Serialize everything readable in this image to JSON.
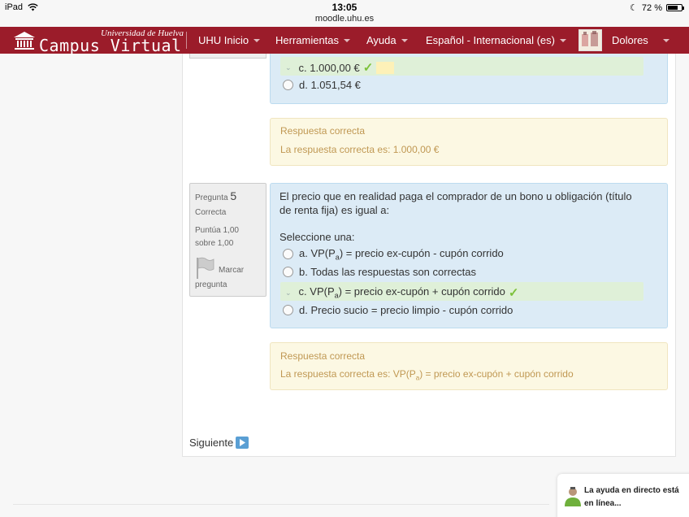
{
  "statusbar": {
    "device": "iPad",
    "time": "13:05",
    "url": "moodle.uhu.es",
    "battery": "72 %"
  },
  "navbar": {
    "logo_university": "Universidad de Huelva",
    "logo_title": "Campus Virtual",
    "items": [
      {
        "label": "UHU Inicio"
      },
      {
        "label": "Herramientas"
      },
      {
        "label": "Ayuda"
      },
      {
        "label": "Español - Internacional (es)"
      }
    ],
    "user_name": "Dolores",
    "color": "#9b1c2a"
  },
  "question4": {
    "answers": [
      {
        "label": "c. 1.000,00 €",
        "correct": true
      },
      {
        "label": "d. 1.051,54 €",
        "correct": false
      }
    ],
    "feedback_title": "Respuesta correcta",
    "feedback_text": "La respuesta correcta es: 1.000,00 €"
  },
  "question5": {
    "info_label": "Pregunta",
    "number": "5",
    "state": "Correcta",
    "grade": "Puntúa 1,00 sobre 1,00",
    "flag_label": "Marcar pregunta",
    "text": "El precio que en realidad paga el comprador de un bono u obligación (título de renta fija) es igual a:",
    "prompt": "Seleccione una:",
    "answers": [
      {
        "prefix": "a. VP(P",
        "sub": "a",
        "suffix": ") = precio ex-cupón - cupón corrido",
        "correct": false
      },
      {
        "prefix": "b. Todas las respuestas son correctas",
        "sub": "",
        "suffix": "",
        "correct": false
      },
      {
        "prefix": "c. VP(P",
        "sub": "a",
        "suffix": ") = precio ex-cupón + cupón corrido",
        "correct": true
      },
      {
        "prefix": "d. Precio sucio = precio limpio - cupón corrido",
        "sub": "",
        "suffix": "",
        "correct": false
      }
    ],
    "feedback_title": "Respuesta correcta",
    "feedback_prefix": "La respuesta correcta es: VP(P",
    "feedback_sub": "a",
    "feedback_suffix": ") = precio ex-cupón + cupón corrido"
  },
  "navigation": {
    "next_label": "Siguiente"
  },
  "help": {
    "line1": "La ayuda en directo está",
    "line2": "en línea..."
  }
}
